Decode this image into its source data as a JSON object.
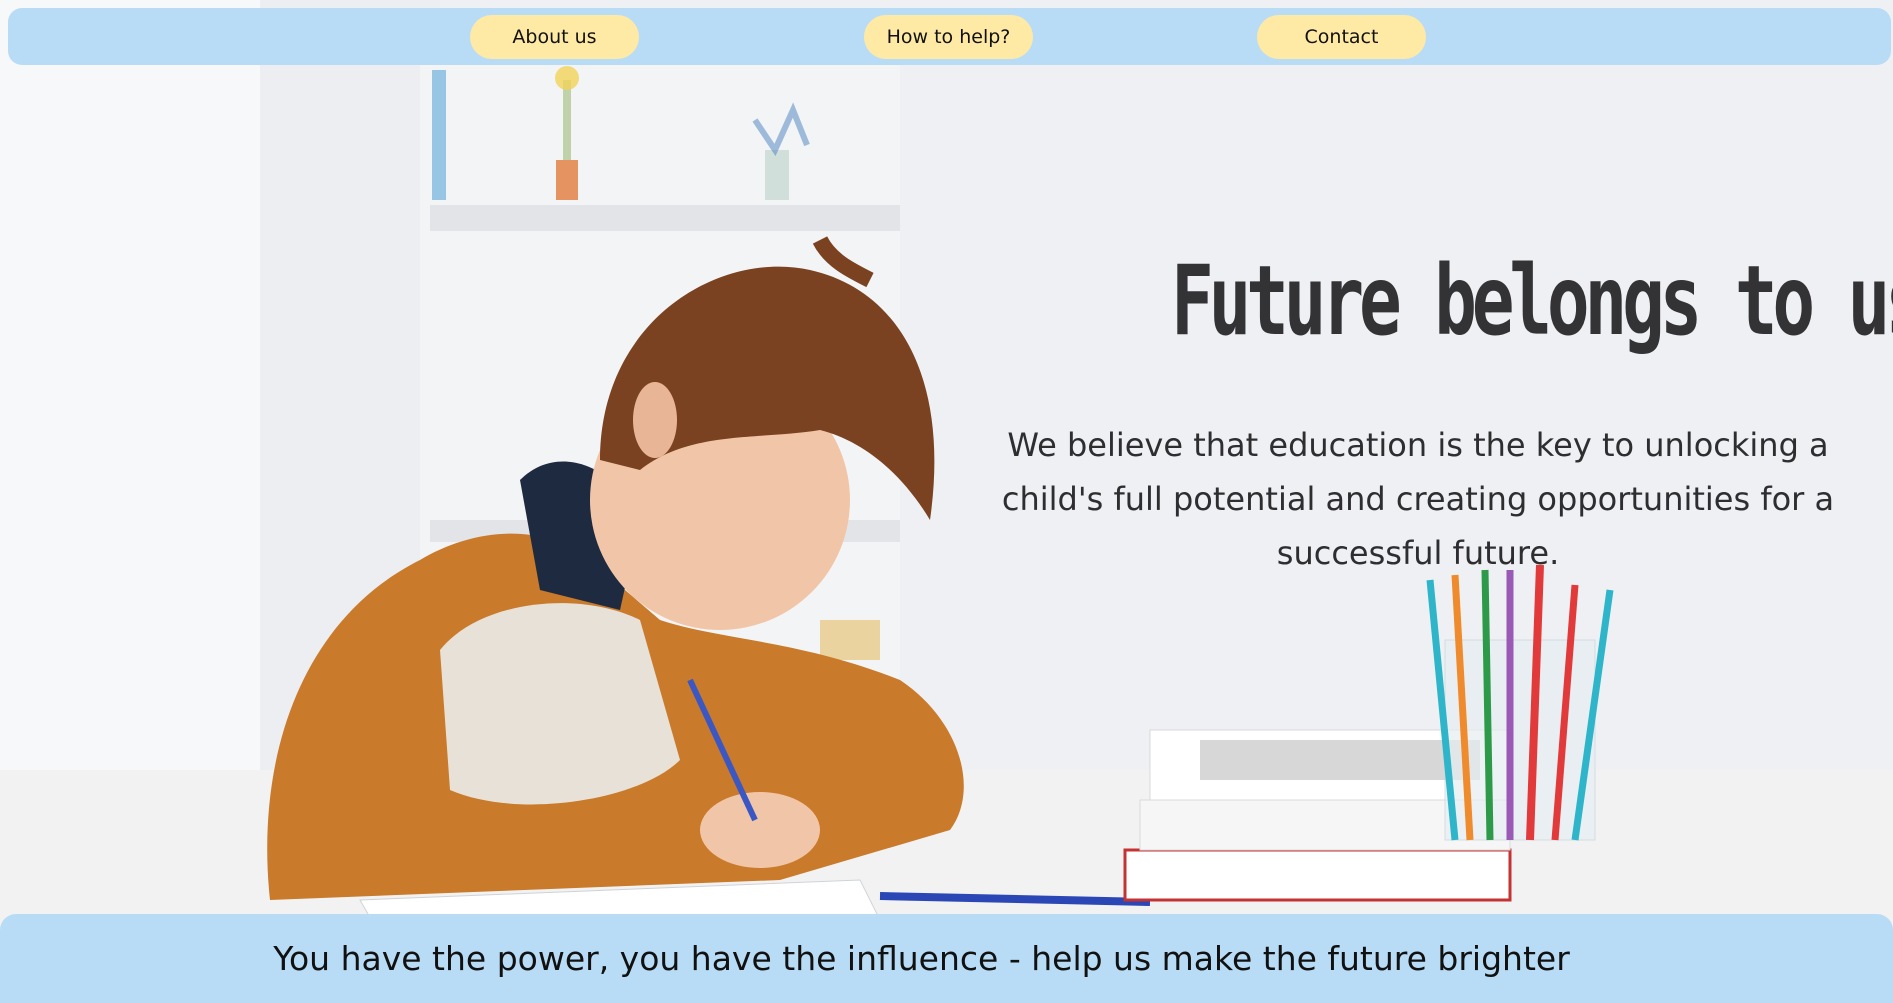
{
  "nav": {
    "items": [
      {
        "label": "About us"
      },
      {
        "label": "How to help?"
      },
      {
        "label": "Contact"
      }
    ]
  },
  "hero": {
    "headline": "Future belongs to us!",
    "tagline": "We believe that education is the key to unlocking a child's full potential and creating opportunities for a successful future."
  },
  "footer": {
    "message": "You have the power, you have the influence - help us make the future brighter"
  },
  "colors": {
    "nav_bar": "#b9dcf6",
    "nav_button": "#ffeaa5",
    "headline_text": "#333336"
  }
}
